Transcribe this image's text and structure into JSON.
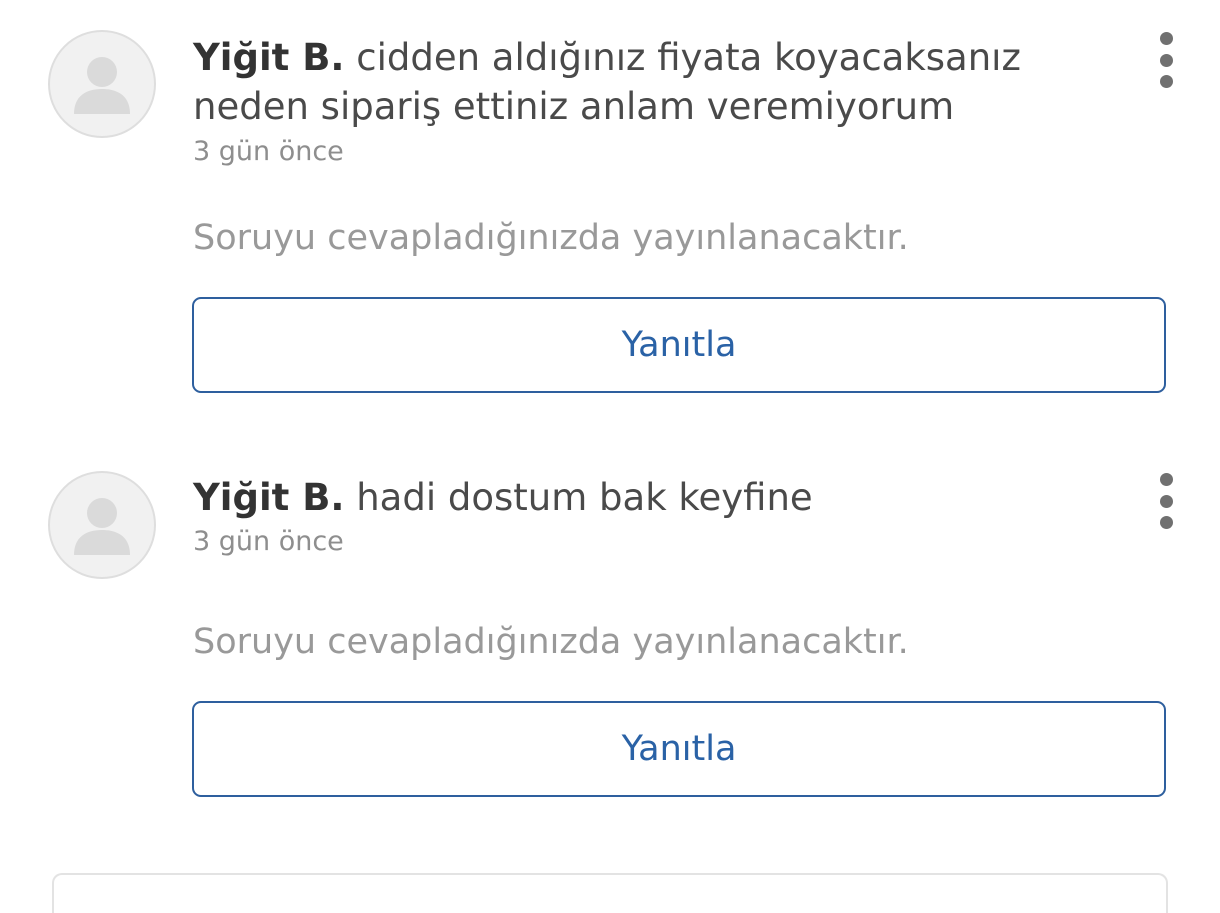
{
  "questions": [
    {
      "author": "Yiğit B.",
      "text": "cidden aldığınız fiyata koyacaksanız neden sipariş ettiniz anlam veremiyorum",
      "time": "3 gün önce",
      "pending_note": "Soruyu cevapladığınızda yayınlanacaktır.",
      "reply_label": "Yanıtla",
      "avatar_icon": "user-silhouette-icon",
      "menu_icon": "more-vertical-icon"
    },
    {
      "author": "Yiğit B.",
      "text": "hadi dostum bak keyfine",
      "time": "3 gün önce",
      "pending_note": "Soruyu cevapladığınızda yayınlanacaktır.",
      "reply_label": "Yanıtla",
      "avatar_icon": "user-silhouette-icon",
      "menu_icon": "more-vertical-icon"
    }
  ],
  "colors": {
    "accent": "#2a62a6",
    "button_border": "#2e5f9e",
    "muted_text": "#999999",
    "body_text": "#4a4a4a"
  }
}
